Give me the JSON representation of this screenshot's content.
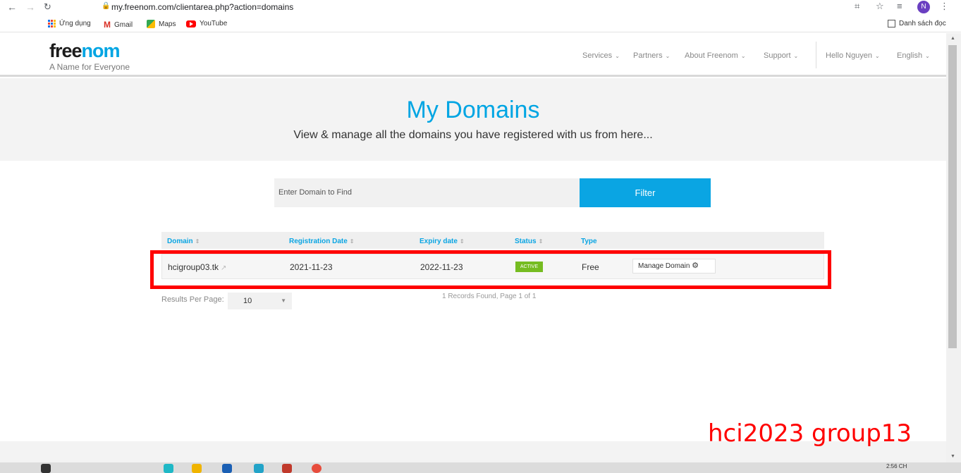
{
  "browser": {
    "url": "my.freenom.com/clientarea.php?action=domains",
    "profile_initial": "N",
    "bookmarks": [
      "Ứng dụng",
      "Gmail",
      "Maps",
      "YouTube"
    ],
    "reading_list": "Danh sách đọc"
  },
  "header": {
    "logo_part1": "free",
    "logo_part2": "nom",
    "tagline": "A Name for Everyone",
    "menu": [
      "Services",
      "Partners",
      "About Freenom",
      "Support"
    ],
    "user": "Hello Nguyen",
    "language": "English"
  },
  "hero": {
    "title": "My Domains",
    "subtitle": "View & manage all the domains you have registered with us from here..."
  },
  "search": {
    "placeholder": "Enter Domain to Find",
    "button": "Filter"
  },
  "table": {
    "columns": [
      "Domain",
      "Registration Date",
      "Expiry date",
      "Status",
      "Type"
    ],
    "rows": [
      {
        "domain": "hcigroup03.tk",
        "registration_date": "2021-11-23",
        "expiry_date": "2022-11-23",
        "status": "ACTIVE",
        "type": "Free",
        "action": "Manage Domain"
      }
    ]
  },
  "pagination": {
    "results_label": "Results Per Page:",
    "results_value": "10",
    "records": "1 Records Found, Page 1 of 1"
  },
  "watermark": "hci2023 group13",
  "taskbar": {
    "time": "2:56 CH"
  },
  "colors": {
    "brand_blue": "#00a5e3",
    "active_green": "#76bc21",
    "highlight_red": "#ff0000"
  }
}
